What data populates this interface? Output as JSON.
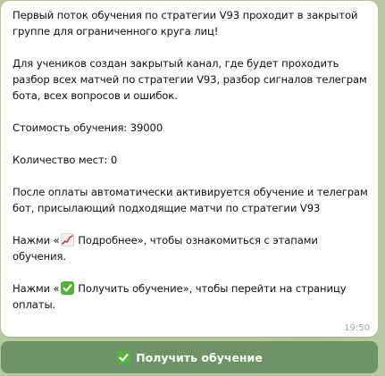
{
  "message": {
    "para1": "Первый поток обучения по стратегии V93 проходит в закрытой группе для ограниченного круга лиц!",
    "para2": "Для учеников создан закрытый канал, где будет проходить разбор всех матчей по стратегии V93, разбор сигналов телеграм бота, всех вопросов и ошибок.",
    "price": "Стоимость обучения: 39000",
    "seats": "Количество мест: 0",
    "para3": "После оплаты автоматически активируется обучение и телеграм бот, присылающий подходящие матчи по стратегии V93",
    "details_prefix": "Нажми «",
    "details_text": " Подробнее», чтобы ознакомиться с этапами обучения.",
    "get_prefix": "Нажми «",
    "get_text": " Получить обучение», чтобы перейти на страницу оплаты.",
    "time": "19:50"
  },
  "button": {
    "label": "Получить обучение"
  },
  "icons": {
    "chart": "chart-increasing-icon",
    "check": "check-mark-button-icon"
  },
  "colors": {
    "background": "#b6c99e",
    "bubble": "#ffffff",
    "button": "#5e8a5c",
    "check_green": "#4fb33e",
    "time": "#a0aab0"
  }
}
